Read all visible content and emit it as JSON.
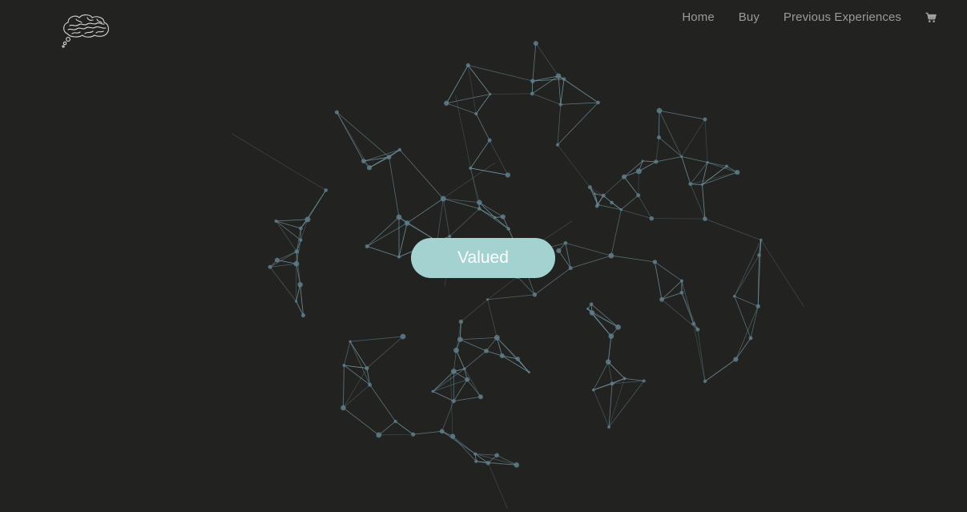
{
  "nav": {
    "items": [
      {
        "label": "Home"
      },
      {
        "label": "Buy"
      },
      {
        "label": "Previous Experiences"
      }
    ],
    "cart_icon": "shopping-cart-icon"
  },
  "logo": {
    "icon": "brain-thought-bubble-icon"
  },
  "hero": {
    "button_label": "Valued"
  },
  "colors": {
    "background": "#222220",
    "network_line": "#7fa6b4",
    "network_node": "#5f7d89",
    "button_bg": "#a3d2d0",
    "nav_text": "#9a9a9a"
  }
}
